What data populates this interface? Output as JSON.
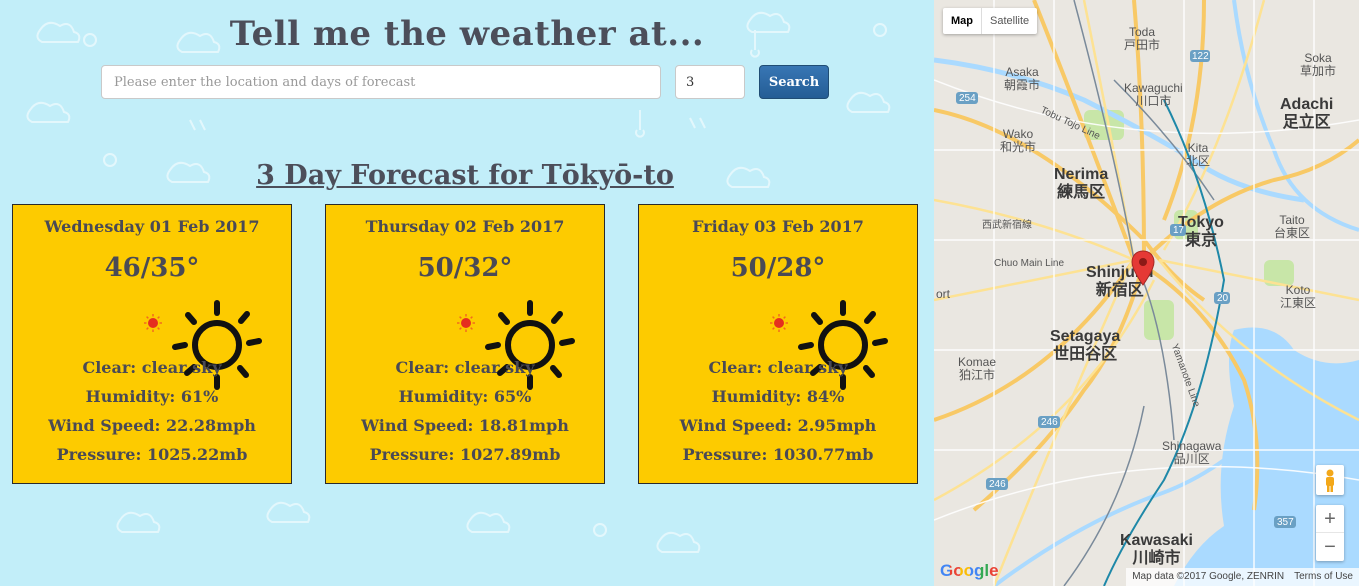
{
  "header": {
    "title": "Tell me the weather at..."
  },
  "search": {
    "placeholder": "Please enter the location and days of forecast",
    "days_value": "3",
    "button_label": "Search"
  },
  "forecast": {
    "heading": "3 Day Forecast for Tōkyō-to",
    "days": [
      {
        "date": "Wednesday 01 Feb 2017",
        "temp": "46/35°",
        "description": "Clear: clear sky",
        "humidity": "Humidity: 61%",
        "wind": "Wind Speed: 22.28mph",
        "pressure": "Pressure: 1025.22mb",
        "icon": "sun-icon"
      },
      {
        "date": "Thursday 02 Feb 2017",
        "temp": "50/32°",
        "description": "Clear: clear sky",
        "humidity": "Humidity: 65%",
        "wind": "Wind Speed: 18.81mph",
        "pressure": "Pressure: 1027.89mb",
        "icon": "sun-icon"
      },
      {
        "date": "Friday 03 Feb 2017",
        "temp": "50/28°",
        "description": "Clear: clear sky",
        "humidity": "Humidity: 84%",
        "wind": "Wind Speed: 2.95mph",
        "pressure": "Pressure: 1030.77mb",
        "icon": "sun-icon"
      }
    ]
  },
  "map": {
    "type_buttons": {
      "map": "Map",
      "satellite": "Satellite"
    },
    "labels": {
      "toda_en": "Toda",
      "toda_ja": "戸田市",
      "soka_en": "Soka",
      "soka_ja": "草加市",
      "asaka_en": "Asaka",
      "asaka_ja": "朝霞市",
      "kawaguchi_en": "Kawaguchi",
      "kawaguchi_ja": "川口市",
      "adachi_en": "Adachi",
      "adachi_ja": "足立区",
      "wako_en": "Wako",
      "wako_ja": "和光市",
      "tobu_tojo": "Tobu Tojo Line",
      "kita_en": "Kita",
      "kita_ja": "北区",
      "nerima_en": "Nerima",
      "nerima_ja": "練馬区",
      "seibu": "西武新宿線",
      "tokyo_en": "Tokyo",
      "tokyo_ja": "東京",
      "taito_en": "Taito",
      "taito_ja": "台東区",
      "chuo": "Chuo Main Line",
      "shinjuku_en": "Shinjuku",
      "shinjuku_ja": "新宿区",
      "koto_en": "Koto",
      "koto_ja": "江東区",
      "setagaya_en": "Setagaya",
      "setagaya_ja": "世田谷区",
      "komae_en": "Komae",
      "komae_ja": "狛江市",
      "yamanote": "Yamanote Line",
      "shinagawa_en": "Shinagawa",
      "shinagawa_ja": "品川区",
      "kawasaki_en": "Kawasaki",
      "kawasaki_ja": "川崎市",
      "ort": "ort",
      "road_122": "122",
      "road_254": "254",
      "road_17": "17",
      "road_246": "246",
      "road_357": "357",
      "road_20": "20"
    },
    "google_logo": "Google",
    "attribution": "Map data ©2017 Google, ZENRIN",
    "terms": "Terms of Use",
    "colors": {
      "water": "#aadaff",
      "park": "#c8e6a8",
      "highway": "#f8c966",
      "road": "#ffffff",
      "marker": "#e53935"
    }
  }
}
